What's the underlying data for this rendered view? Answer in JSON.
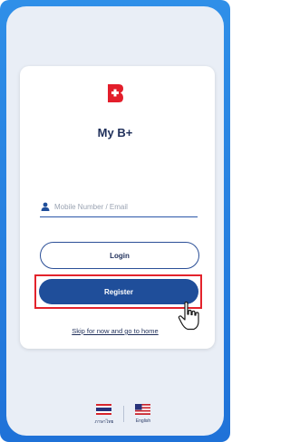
{
  "app": {
    "name": "My B+"
  },
  "login_form": {
    "identifier_placeholder": "Mobile Number / Email",
    "login_label": "Login",
    "register_label": "Register",
    "skip_link": "Skip for now and go to home"
  },
  "languages": [
    {
      "label": "ภาษาไทย",
      "flag": "thai-flag-icon"
    },
    {
      "label": "English",
      "flag": "us-flag-icon"
    }
  ],
  "colors": {
    "frame_blue": "#2f8fe8",
    "primary_navy": "#1f4e9a",
    "logo_red": "#e31e2b",
    "highlight_red": "#e3232c"
  }
}
